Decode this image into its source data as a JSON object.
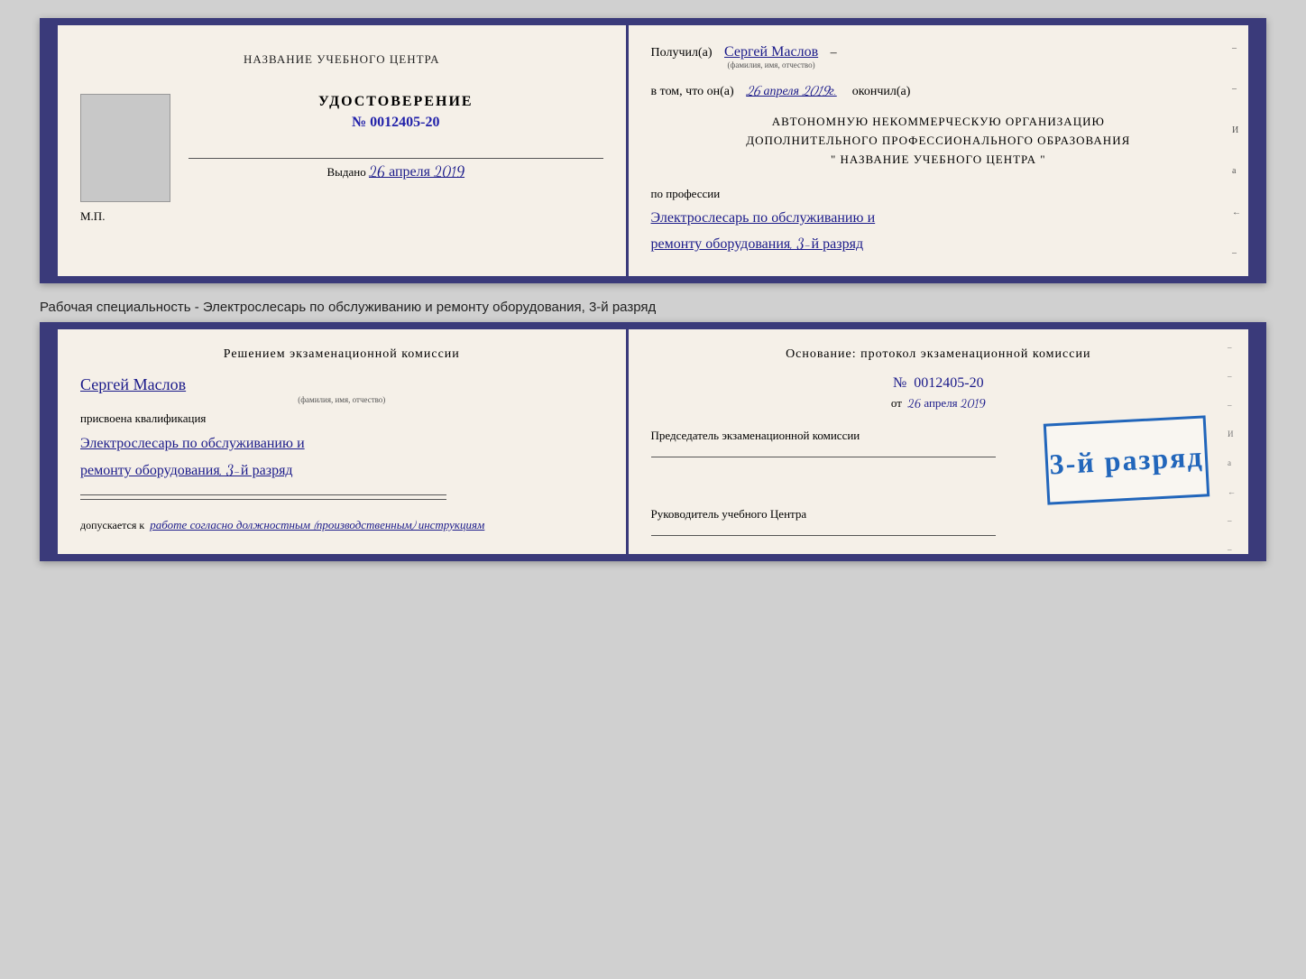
{
  "top_cert": {
    "left": {
      "header": "НАЗВАНИЕ УЧЕБНОГО ЦЕНТРА",
      "udostoverenie_label": "УДОСТОВЕРЕНИЕ",
      "number_prefix": "№",
      "number": "0012405-20",
      "vydano_label": "Выдано",
      "vydano_date": "26 апреля 2019",
      "mp_label": "М.П."
    },
    "right": {
      "poluchil_label": "Получил(а)",
      "recipient_name": "Сергей Маслов",
      "fio_label": "(фамилия, имя, отчество)",
      "dash": "–",
      "vtom_label": "в том, что он(а)",
      "date_val": "26 апреля 2019г.",
      "okonchil_label": "окончил(а)",
      "org_line1": "АВТОНОМНУЮ НЕКОММЕРЧЕСКУЮ ОРГАНИЗАЦИЮ",
      "org_line2": "ДОПОЛНИТЕЛЬНОГО ПРОФЕССИОНАЛЬНОГО ОБРАЗОВАНИЯ",
      "org_line3": "\"    НАЗВАНИЕ УЧЕБНОГО ЦЕНТРА    \"",
      "po_professii_label": "по профессии",
      "profession_line1": "Электрослесарь по обслуживанию и",
      "profession_line2": "ремонту оборудования, 3-й разряд"
    }
  },
  "between_label": "Рабочая специальность - Электрослесарь по обслуживанию и ремонту оборудования, 3-й разряд",
  "bottom_cert": {
    "left": {
      "resheniem_header": "Решением  экзаменационной  комиссии",
      "name": "Сергей Маслов",
      "fio_label": "(фамилия, имя, отчество)",
      "prisvoena_label": "присвоена квалификация",
      "qualification_line1": "Электрослесарь по обслуживанию и",
      "qualification_line2": "ремонту оборудования, 3-й разряд",
      "dopuskaetsya_label": "допускается к",
      "dopusk_text": "работе согласно должностным (производственным) инструкциям"
    },
    "right": {
      "osnova_header": "Основание: протокол  экзаменационной  комиссии",
      "number_prefix": "№",
      "number": "0012405-20",
      "ot_label": "от",
      "date_val": "26 апреля 2019",
      "predsedatel_label": "Председатель экзаменационной комиссии",
      "stamp_text": "3-й разряд",
      "rukovoditel_label": "Руководитель учебного Центра"
    }
  },
  "edge_chars": {
    "right_top": [
      "И",
      "а",
      "←",
      "–"
    ],
    "right_bottom": [
      "И",
      "а",
      "←",
      "–"
    ]
  }
}
